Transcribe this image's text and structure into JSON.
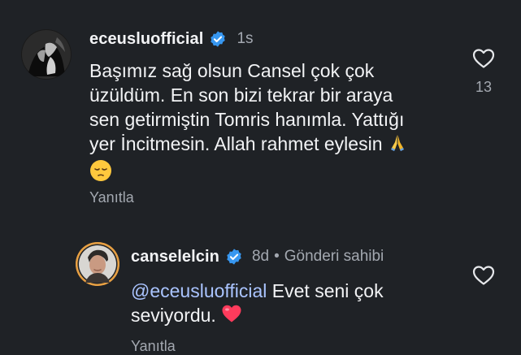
{
  "comments": [
    {
      "username": "eceusluofficial",
      "verified": true,
      "time": "1s",
      "lines": [
        "Başımız sağ olsun Cansel çok çok",
        "üzüldüm. En son bizi tekrar bir araya",
        "sen getirmiştin Tomris hanımla. Yattığı",
        "yer İncitmesin. Allah rahmet eylesin"
      ],
      "emojis": [
        "folded-hands",
        "pensive-face"
      ],
      "reply_label": "Yanıtla",
      "like_count": "13"
    },
    {
      "username": "canselelcin",
      "verified": true,
      "time": "8d",
      "author_label": "Gönderi sahibi",
      "mention": "@eceusluofficial",
      "line1_rest": " Evet seni çok",
      "line2": "seviyordu.",
      "emoji": "red-heart",
      "reply_label": "Yanıtla"
    }
  ],
  "colors": {
    "background": "#1f2226",
    "text": "#f2f3f5",
    "muted": "#a3a8b0",
    "mention": "#aac4ff",
    "verified": "#3797f0",
    "heart": "#ff3b5c"
  },
  "icons": {
    "like": "heart-outline-icon",
    "verified": "verified-badge-icon"
  }
}
